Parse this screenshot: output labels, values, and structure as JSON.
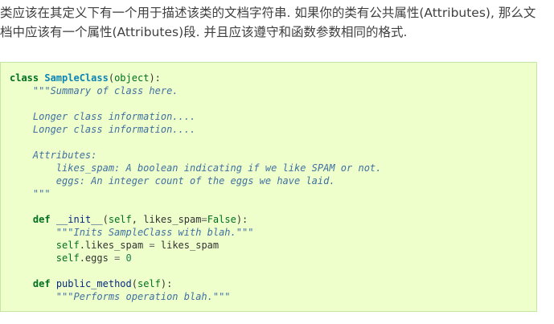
{
  "paragraph": {
    "line1": "类应该在其定义下有一个用于描述该类的文档字符串. 如果你的类有公共属性(Attributes), 那么文",
    "line2": "档中应该有一个属性(Attributes)段. 并且应该遵守和函数参数相同的格式."
  },
  "code": {
    "l1": {
      "kw": "class",
      "name": "SampleClass",
      "open": "(",
      "base": "object",
      "close": "):"
    },
    "l2": {
      "indent": "    ",
      "doc": "\"\"\"Summary of class here."
    },
    "l4": {
      "indent": "    ",
      "doc": "Longer class information...."
    },
    "l5": {
      "indent": "    ",
      "doc": "Longer class information...."
    },
    "l7": {
      "indent": "    ",
      "doc": "Attributes:"
    },
    "l8": {
      "indent": "        ",
      "doc": "likes_spam: A boolean indicating if we like SPAM or not."
    },
    "l9": {
      "indent": "        ",
      "doc": "eggs: An integer count of the eggs we have laid."
    },
    "l10": {
      "indent": "    ",
      "doc": "\"\"\""
    },
    "l12": {
      "indent": "    ",
      "kw": "def",
      "name": "__init__",
      "open": "(",
      "self": "self",
      "mid": ", likes_spam",
      "eq": "=",
      "const": "False",
      "close": "):"
    },
    "l13": {
      "indent": "        ",
      "doc": "\"\"\"Inits SampleClass with blah.\"\"\""
    },
    "l14": {
      "indent": "        ",
      "self": "self",
      "attr": ".likes_spam ",
      "eq": "=",
      "rest": " likes_spam"
    },
    "l15": {
      "indent": "        ",
      "self": "self",
      "attr": ".eggs ",
      "eq": "=",
      "sp": " ",
      "num": "0"
    },
    "l17": {
      "indent": "    ",
      "kw": "def",
      "name": "public_method",
      "open": "(",
      "self": "self",
      "close": "):"
    },
    "l18": {
      "indent": "        ",
      "doc": "\"\"\"Performs operation blah.\"\"\""
    }
  }
}
